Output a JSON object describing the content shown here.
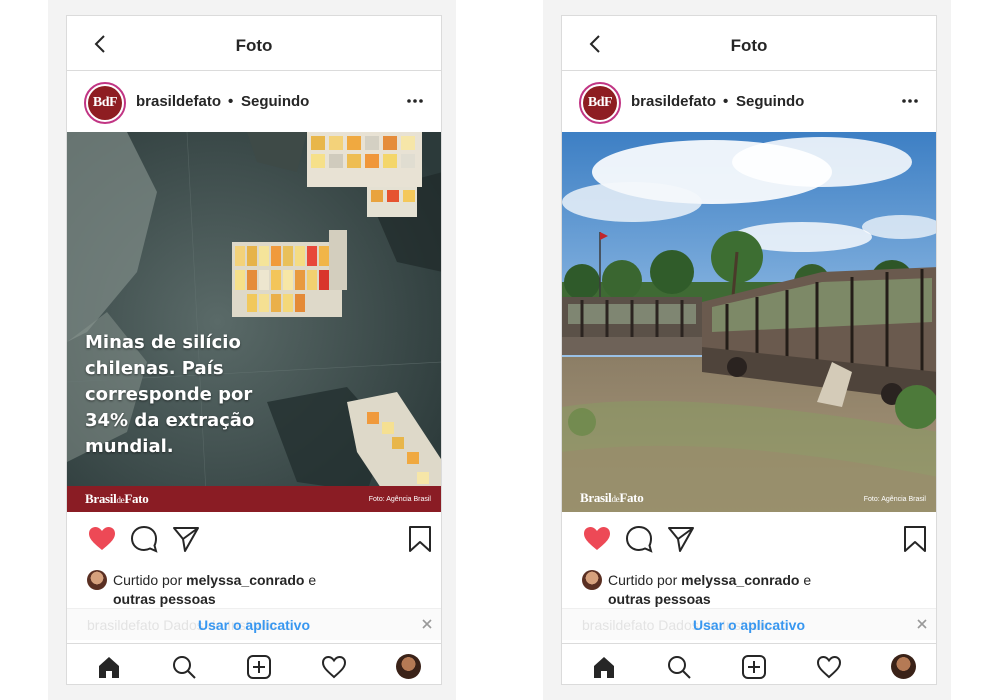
{
  "nav_title": "Foto",
  "account": {
    "username": "brasildefato",
    "separator": "•",
    "follow_status": "Seguindo",
    "avatar_text": "BdF"
  },
  "posts": [
    {
      "caption": "Minas de silício chilenas. País corresponde por 34% da extração mundial.",
      "brand_main": "Brasil",
      "brand_small": "de",
      "brand_end": "Fato",
      "photo_credit": "Foto: Agência Brasil",
      "photo_subject": "satellite view of mining ponds"
    },
    {
      "caption": "",
      "brand_main": "Brasil",
      "brand_small": "de",
      "brand_end": "Fato",
      "photo_credit": "Foto: Agência Brasil",
      "photo_subject": "burned buses in a field"
    }
  ],
  "likes": {
    "prefix": "Curtido por",
    "user": "melyssa_conrado",
    "conjunction": "e",
    "others": "outras pessoas"
  },
  "app_banner": {
    "ghost_text": "brasildefato Dados do Instituto...",
    "cta": "Usar o aplicativo"
  },
  "colors": {
    "brand_red": "#8a1c24",
    "like_red": "#ed4956",
    "link_blue": "#3897f0"
  },
  "icons": [
    "back-icon",
    "more-icon",
    "heart-icon",
    "comment-icon",
    "share-icon",
    "bookmark-icon",
    "close-icon",
    "home-icon",
    "search-icon",
    "add-icon",
    "activity-icon",
    "profile-icon"
  ]
}
